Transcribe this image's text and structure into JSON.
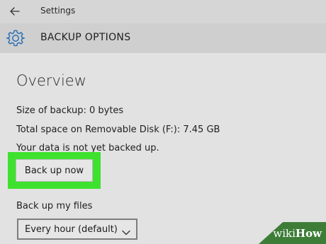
{
  "titlebar": {
    "back_icon": "arrow-left-icon",
    "app_title": "Settings"
  },
  "page_header": {
    "icon": "gear-icon",
    "icon_color": "#2b6fb5",
    "title": "BACKUP OPTIONS"
  },
  "overview": {
    "title": "Overview",
    "size_of_backup": "Size of backup: 0 bytes",
    "total_space": "Total space on Removable Disk (F:): 7.45 GB",
    "status": "Your data is not yet backed up.",
    "backup_now_label": "Back up now",
    "highlight_color": "#3fe12f"
  },
  "backup_files": {
    "label": "Back up my files",
    "frequency_selected": "Every hour (default)",
    "dropdown_icon": "chevron-down-icon"
  },
  "watermark": {
    "wiki": "wiki",
    "how": "How",
    "color": "#3d7d38"
  }
}
